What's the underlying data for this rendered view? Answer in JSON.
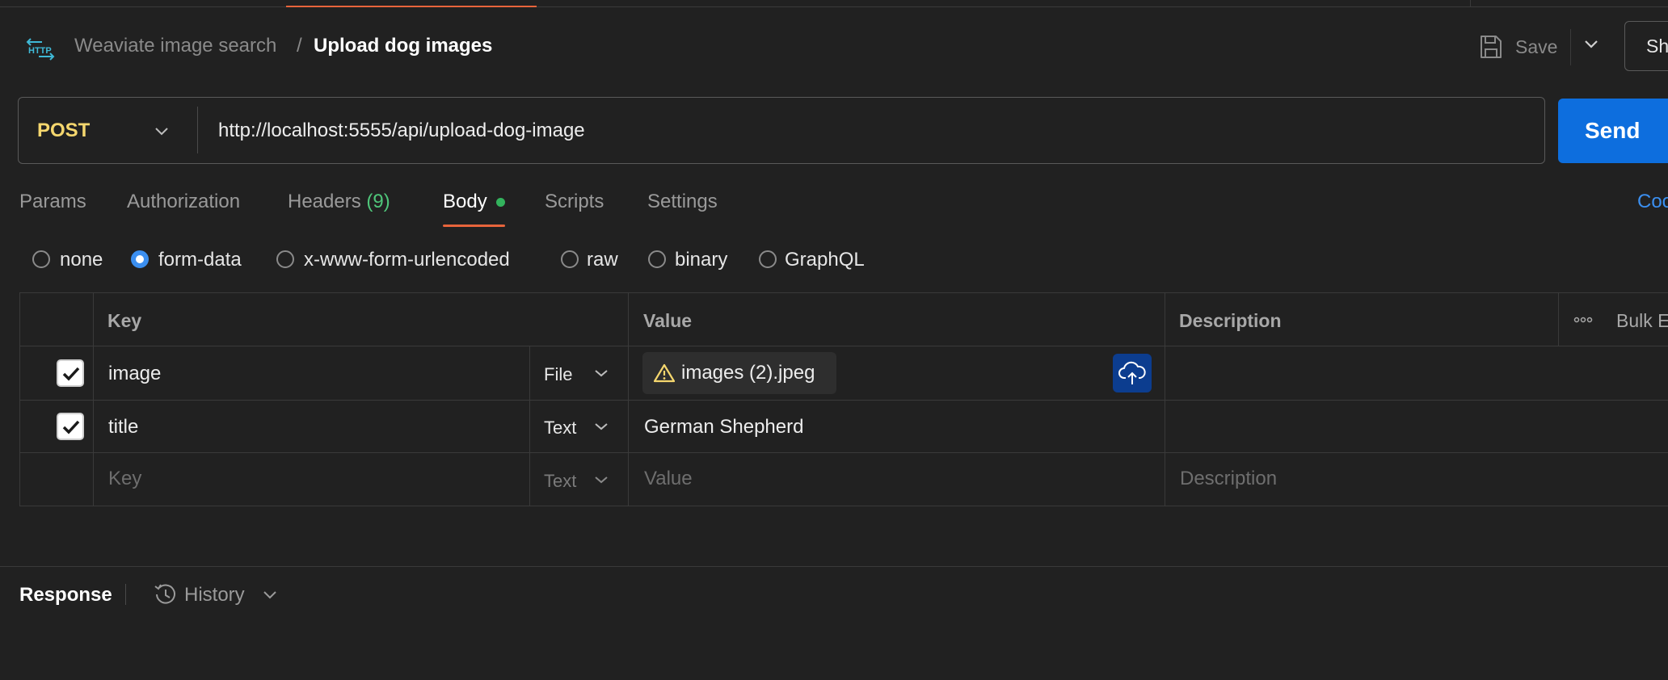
{
  "header": {
    "breadcrumb_parent": "Weaviate image search",
    "breadcrumb_separator": "/",
    "title": "Upload dog images",
    "save_label": "Save",
    "share_label": "Sh"
  },
  "request": {
    "method": "POST",
    "url": "http://localhost:5555/api/upload-dog-image",
    "send_label": "Send"
  },
  "tabs": [
    {
      "label": "Params"
    },
    {
      "label": "Authorization"
    },
    {
      "label": "Headers",
      "count": "(9)"
    },
    {
      "label": "Body"
    },
    {
      "label": "Scripts"
    },
    {
      "label": "Settings"
    }
  ],
  "code_link": "Coo",
  "body_types": [
    {
      "label": "none",
      "selected": false
    },
    {
      "label": "form-data",
      "selected": true
    },
    {
      "label": "x-www-form-urlencoded",
      "selected": false
    },
    {
      "label": "raw",
      "selected": false
    },
    {
      "label": "binary",
      "selected": false
    },
    {
      "label": "GraphQL",
      "selected": false
    }
  ],
  "table": {
    "headers": {
      "key": "Key",
      "value": "Value",
      "description": "Description",
      "bulk_edit": "Bulk E"
    },
    "rows": [
      {
        "checked": true,
        "key": "image",
        "type": "File",
        "value": "images (2).jpeg",
        "description": ""
      },
      {
        "checked": true,
        "key": "title",
        "type": "Text",
        "value": "German Shepherd",
        "description": ""
      }
    ],
    "placeholders": {
      "key": "Key",
      "type": "Text",
      "value": "Value",
      "description": "Description"
    }
  },
  "response": {
    "label": "Response",
    "history_label": "History"
  },
  "colors": {
    "background": "#212121",
    "accent": "#e8643b",
    "primary": "#0d6ede",
    "method_post": "#f5d76e",
    "success": "#33b35d"
  }
}
